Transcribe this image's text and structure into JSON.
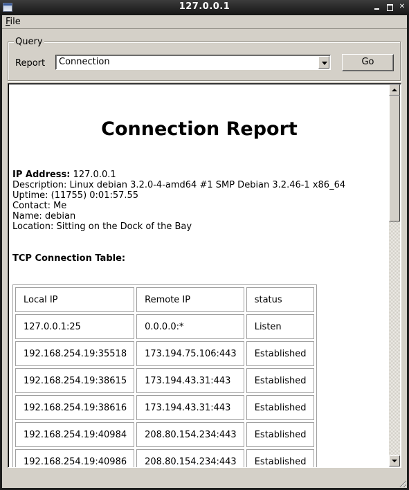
{
  "window": {
    "title": "127.0.0.1",
    "controls": {
      "minimize": "minimize",
      "maximize": "maximize",
      "close": "close"
    }
  },
  "menubar": {
    "file_mnemonic": "F",
    "file_rest": "ile"
  },
  "query": {
    "legend": "Query",
    "report_label": "Report",
    "report_selected": "Connection",
    "go_label": "Go"
  },
  "report": {
    "title": "Connection Report",
    "ip_label": "IP Address:",
    "ip_value": " 127.0.0.1",
    "description": "Description: Linux debian 3.2.0-4-amd64 #1 SMP Debian 3.2.46-1 x86_64",
    "uptime": "Uptime: (11755) 0:01:57.55",
    "contact": "Contact: Me",
    "name": "Name: debian",
    "location": "Location: Sitting on the Dock of the Bay",
    "tcp_table_title": "TCP Connection Table:",
    "table": {
      "headers": [
        "Local IP",
        "Remote IP",
        "status"
      ],
      "rows": [
        [
          "127.0.0.1:25",
          "0.0.0.0:*",
          "Listen"
        ],
        [
          "192.168.254.19:35518",
          "173.194.75.106:443",
          "Established"
        ],
        [
          "192.168.254.19:38615",
          "173.194.43.31:443",
          "Established"
        ],
        [
          "192.168.254.19:38616",
          "173.194.43.31:443",
          "Established"
        ],
        [
          "192.168.254.19:40984",
          "208.80.154.234:443",
          "Established"
        ],
        [
          "192.168.254.19:40986",
          "208.80.154.234:443",
          "Established"
        ]
      ]
    }
  },
  "scrollbar": {
    "position_fraction": 0.0,
    "visible_fraction": 0.35
  }
}
